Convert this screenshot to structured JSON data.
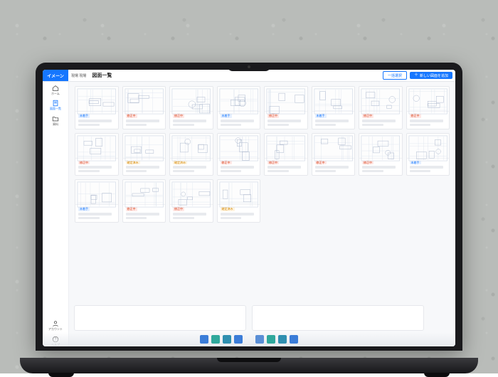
{
  "brand": "イメーン",
  "breadcrumb": "現場 現場",
  "page_title": "図面一覧",
  "buttons": {
    "outline": "一括選択",
    "primary": "新しい図面を追加"
  },
  "sidebar": [
    {
      "icon": "home",
      "label": "ホーム"
    },
    {
      "icon": "doc",
      "label": "図面一覧",
      "active": true
    },
    {
      "icon": "folder",
      "label": "資料"
    },
    {
      "icon": "user",
      "label": "アカウント"
    },
    {
      "icon": "help",
      "label": "ヘルプ"
    }
  ],
  "tags": {
    "blue": "未着手",
    "red": "修正中",
    "orange": "確定済み"
  },
  "cards": [
    {
      "tag": "blue"
    },
    {
      "tag": "red"
    },
    {
      "tag": "red"
    },
    {
      "tag": "blue"
    },
    {
      "tag": "red"
    },
    {
      "tag": "blue"
    },
    {
      "tag": "red"
    },
    {
      "tag": "red"
    },
    {
      "tag": "red"
    },
    {
      "tag": "orange"
    },
    {
      "tag": "orange"
    },
    {
      "tag": "red"
    },
    {
      "tag": "red"
    },
    {
      "tag": "red"
    },
    {
      "tag": "red"
    },
    {
      "tag": "blue"
    },
    {
      "tag": "blue"
    },
    {
      "tag": "red"
    },
    {
      "tag": "red"
    },
    {
      "tag": "orange"
    }
  ],
  "dock_colors": [
    "#3b7dd8",
    "#2fa89c",
    "#2f8fb0",
    "#3b7dd8",
    "gap",
    "#5a8fd6",
    "#2fa89c",
    "#2f8fb0",
    "#3b7dd8"
  ]
}
